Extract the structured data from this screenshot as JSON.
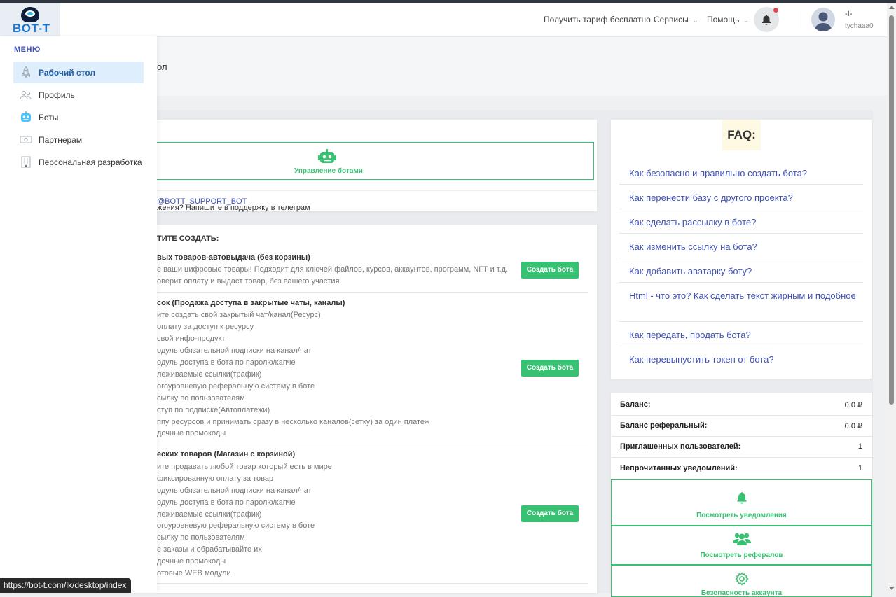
{
  "header": {
    "logo_text": "BOT-T",
    "links": [
      "Получить тариф бесплатно",
      "Сервисы",
      "Помощь"
    ],
    "user_name": "-I-",
    "user_login": "tychaaa0"
  },
  "page": {
    "title_fragment": "ол"
  },
  "sidebar": {
    "menu_title": "МЕНЮ",
    "items": [
      {
        "label": "Рабочий стол",
        "icon": "rocket-icon",
        "active": true
      },
      {
        "label": "Профиль",
        "icon": "users-icon"
      },
      {
        "label": "Боты",
        "icon": "robot-icon"
      },
      {
        "label": "Партнерам",
        "icon": "money-icon"
      },
      {
        "label": "Персональная разработка",
        "icon": "building-icon"
      }
    ]
  },
  "bots_panel": {
    "manage_label": "Управление ботами",
    "support_text": "жения? Напишите в поддержку в телеграм",
    "support_link": "@BOTT_SUPPORT_BOT"
  },
  "create": {
    "title": "ТИТЕ СОЗДАТЬ:",
    "button_label": "Создать бота",
    "products": [
      {
        "title": "вых товаров-автовыдача (без корзины)",
        "lines": [
          "е ваши цифровые товары! Подходит для ключей,файлов, курсов, аккаунтов, программ, NFT и т.д.",
          "оверит оплату и выдаст товар, без вашего участия"
        ]
      },
      {
        "title": "сок (Продажа доступа в закрытые чаты, каналы)",
        "lines": [
          "ите создать свой закрытый чат/канал(Ресурс)",
          "оплату за доступ к ресурсу",
          " свой инфо-продукт",
          "одуль обязательной подписки на канал/чат",
          "одуль доступа в бота по паролю/капче",
          "леживаемые ссылки(трафик)",
          "огоуровневую реферальную систему в боте",
          "сылку по пользователям",
          "ступ по подписке(Автоплатежи)",
          "ппу ресурсов и принимать сразу в несколько каналов(сетку) за один платеж",
          "дочные промокоды"
        ]
      },
      {
        "title": "еских товаров (Магазин с корзиной)",
        "lines": [
          "ите продавать любой товар который есть в мире",
          " фиксированную оплату за товар",
          "одуль обязательной подписки на канал/чат",
          "одуль доступа в бота по паролю/капче",
          "леживаемые ссылки(трафик)",
          "огоуровневую реферальную систему в боте",
          "сылку по пользователям",
          "е заказы и обрабатывайте их",
          "дочные промокоды",
          "отовые WEB модули"
        ]
      }
    ]
  },
  "faq": {
    "title": "FAQ:",
    "items": [
      "Как безопасно и правильно создать бота?",
      "Как перенести базу с другого проекта?",
      "Как сделать рассылку в боте?",
      "Как изменить ссылку на бота?",
      "Как добавить аватарку боту?",
      "Html - что это? Как сделать текст жирным и подобное",
      "Как передать, продать бота?",
      "Как перевыпустить токен от бота?"
    ]
  },
  "stats": [
    {
      "label": "Баланс:",
      "value": "0,0 ₽"
    },
    {
      "label": "Баланс реферальный:",
      "value": "0,0 ₽"
    },
    {
      "label": "Приглашенных пользователей:",
      "value": "1"
    },
    {
      "label": "Непрочитанных уведомлений:",
      "value": "1"
    }
  ],
  "actions": {
    "notifications": "Посмотреть уведомления",
    "referrals": "Посмотреть рефералов",
    "security": "Безопасность аккаунта"
  },
  "status_bar": {
    "url": "https://bot-t.com/lk/desktop/index"
  },
  "colors": {
    "accent_green": "#38c172",
    "link_blue": "#3f51b5",
    "notification_dot": "#e8424f"
  }
}
